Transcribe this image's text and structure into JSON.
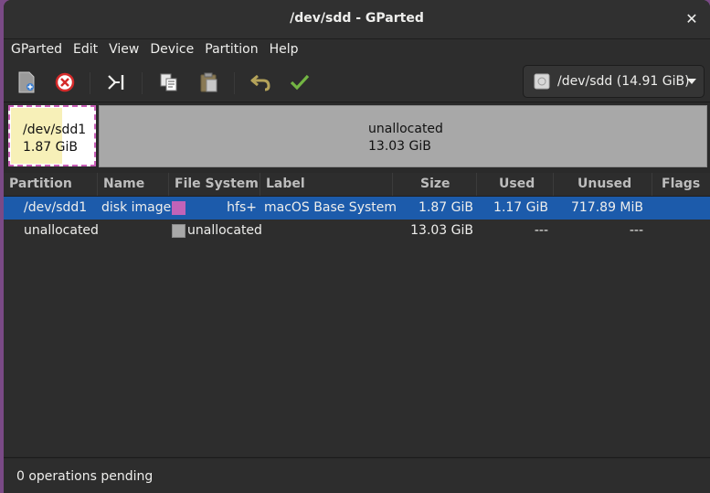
{
  "window": {
    "title": "/dev/sdd - GParted"
  },
  "menubar": [
    "GParted",
    "Edit",
    "View",
    "Device",
    "Partition",
    "Help"
  ],
  "toolbar": {
    "buttons": [
      "new-partition-icon",
      "delete-partition-icon",
      "resize-move-icon",
      "copy-icon",
      "paste-icon",
      "undo-icon",
      "apply-icon"
    ],
    "device_label": "/dev/sdd (14.91 GiB)"
  },
  "partition_map": [
    {
      "name": "/dev/sdd1",
      "size": "1.87 GiB",
      "used_fraction": 0.63,
      "border_color": "#c95fb8",
      "used_color": "#f7f0b8"
    },
    {
      "name": "unallocated",
      "size": "13.03 GiB",
      "color": "#a8a8a8"
    }
  ],
  "table": {
    "columns": [
      "Partition",
      "Name",
      "File System",
      "Label",
      "Size",
      "Used",
      "Unused",
      "Flags"
    ],
    "rows": [
      {
        "partition": "/dev/sdd1",
        "name": "disk image",
        "fs": "hfs+",
        "fs_color": "#c163b8",
        "label": "macOS Base System",
        "size": "1.87 GiB",
        "used": "1.17 GiB",
        "unused": "717.89 MiB",
        "flags": "",
        "selected": true
      },
      {
        "partition": "unallocated",
        "name": "",
        "fs": "unallocated",
        "fs_color": "#a8a8a8",
        "label": "",
        "size": "13.03 GiB",
        "used": "---",
        "unused": "---",
        "flags": "",
        "selected": false
      }
    ]
  },
  "status": {
    "text": "0 operations pending"
  },
  "colors": {
    "selection": "#1c5bab",
    "apply_green": "#73b543",
    "undo_olive": "#b5a35a",
    "delete_red": "#d52a2a"
  }
}
